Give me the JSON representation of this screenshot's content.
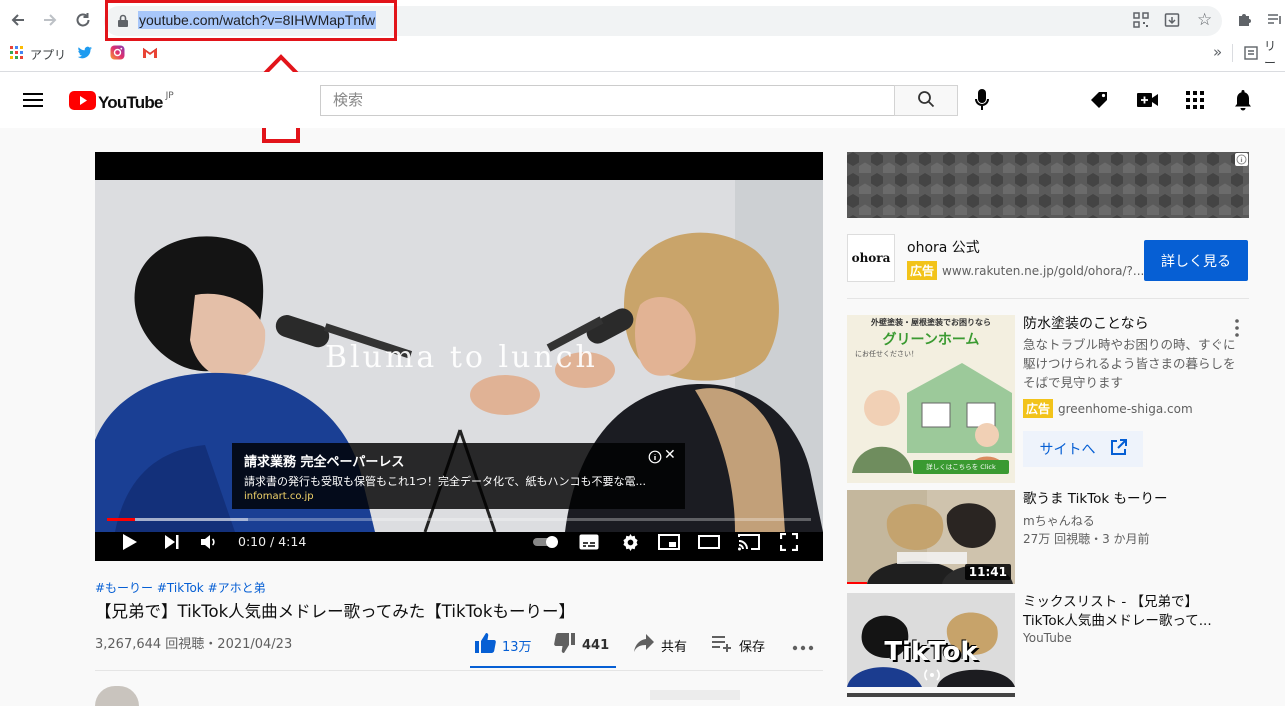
{
  "browser": {
    "url": "youtube.com/watch?v=8IHWMapTnfw",
    "bookmarks": [
      {
        "label": "アプリ",
        "icon": "apps-grid-icon"
      },
      {
        "label": "",
        "icon": "twitter-icon"
      },
      {
        "label": "",
        "icon": "instagram-icon"
      },
      {
        "label": "",
        "icon": "gmail-icon"
      }
    ],
    "overflow_label": "»",
    "reading_list_label": "リー"
  },
  "header": {
    "logo_text": "YouTube",
    "logo_region": "JP",
    "search_placeholder": "検索"
  },
  "video": {
    "overlay_title": "Bluma to lunch",
    "ad": {
      "title": "請求業務 完全ペーパーレス",
      "body": "請求書の発行も受取も保管もこれ1つ！完全データ化で、紙もハンコも不要な電...",
      "domain": "infomart.co.jp"
    },
    "time": "0:10 / 4:14",
    "progress_fraction": 0.04,
    "buffer_fraction": 0.2,
    "hashtags": "#もーりー #TikTok #アホと弟",
    "title": "【兄弟で】TikTok人気曲メドレー歌ってみた【TikTokもーりー】",
    "meta": "3,267,644 回視聴・2021/04/23",
    "likes": "13万",
    "dislikes": "441",
    "share": "共有",
    "save": "保存",
    "accent": "#065fd4"
  },
  "sidebar": {
    "top_ad": {
      "brand_logo": "ohora",
      "name": "ohora 公式",
      "badge": "広告",
      "url": "www.rakuten.ne.jp/gold/ohora/?...",
      "cta": "詳しく見る"
    },
    "items": [
      {
        "title": "防水塗装のことなら",
        "desc": "急なトラブル時やお困りの時、すぐに駆けつけられるよう皆さまの暮らしをそばで見守ります",
        "badge": "広告",
        "domain": "greenhome-shiga.com",
        "cta": "サイトへ",
        "thumb_top": "外壁塗装・屋根塗装でお困りなら",
        "thumb_brand": "グリーンホーム",
        "thumb_sub": "にお任せください！",
        "thumb_btn": "詳しくはこちらを Click"
      },
      {
        "title": "歌うま TikTok もーりー",
        "channel": "mちゃんねる",
        "meta": "27万 回視聴・3 か月前",
        "duration": "11:41"
      },
      {
        "title": "ミックスリスト - 【兄弟で】TikTok人気曲メドレー歌って...",
        "channel": "YouTube",
        "thumb_text": "TikTok"
      }
    ]
  }
}
